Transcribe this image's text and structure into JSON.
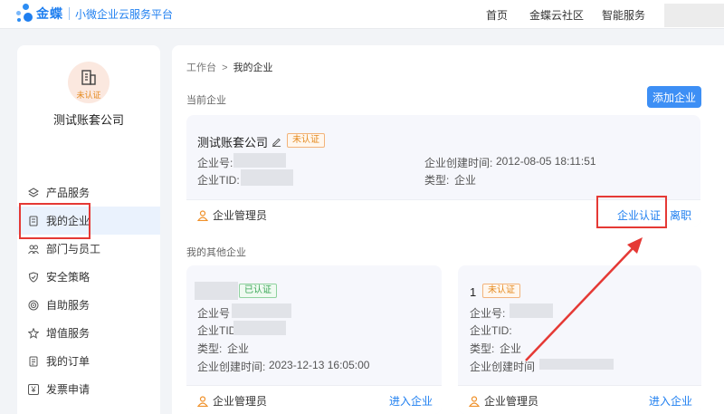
{
  "header": {
    "brand": "金蝶",
    "subtitle": "小微企业云服务平台",
    "nav": [
      "首页",
      "金蝶云社区",
      "智能服务"
    ]
  },
  "sidebar": {
    "badge": "未认证",
    "company": "测试账套公司",
    "items": [
      {
        "label": "产品服务",
        "icon": "layers-icon"
      },
      {
        "label": "我的企业",
        "icon": "document-icon"
      },
      {
        "label": "部门与员工",
        "icon": "people-icon"
      },
      {
        "label": "安全策略",
        "icon": "shield-icon"
      },
      {
        "label": "自助服务",
        "icon": "target-icon"
      },
      {
        "label": "增值服务",
        "icon": "star-icon"
      },
      {
        "label": "我的订单",
        "icon": "list-icon"
      },
      {
        "label": "发票申请",
        "icon": "yen-icon"
      }
    ]
  },
  "main": {
    "breadcrumb": {
      "root": "工作台",
      "sep": ">",
      "current": "我的企业"
    },
    "current_title": "当前企业",
    "add_button": "添加企业",
    "current": {
      "name": "测试账套公司",
      "status": "未认证",
      "id_label": "企业号:",
      "tid_label": "企业TID:",
      "created_label": "企业创建时间:",
      "created_value": "2012-08-05 18:11:51",
      "type_label": "类型:",
      "type_value": "企业",
      "role": "企业管理员",
      "verify_link": "企业认证",
      "leave_link": "离职"
    },
    "others_title": "我的其他企业",
    "others": [
      {
        "status": "已认证",
        "id_label": "企业号",
        "tid_label": "企业TID",
        "type_label": "类型:",
        "type_value": "企业",
        "created_label": "企业创建时间:",
        "created_value": "2023-12-13 16:05:00",
        "role": "企业管理员",
        "link": "进入企业"
      },
      {
        "name": "1",
        "status": "未认证",
        "id_label": "企业号:",
        "tid_label": "企业TID:",
        "type_label": "类型:",
        "type_value": "企业",
        "created_label": "企业创建时间",
        "role": "企业管理员",
        "link": "进入企业"
      }
    ]
  },
  "colors": {
    "accent": "#1f7ff0",
    "annotation": "#e53935",
    "unverified": "#e58a1f",
    "verified": "#3aa757"
  }
}
